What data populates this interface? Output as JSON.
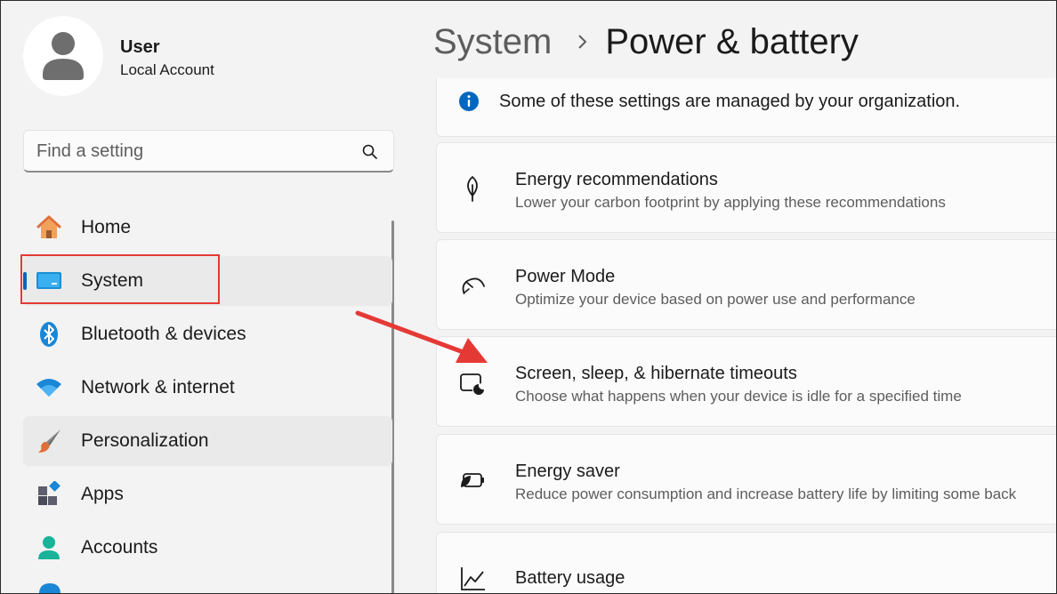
{
  "user": {
    "name": "User",
    "account_type": "Local Account"
  },
  "search": {
    "placeholder": "Find a setting",
    "value": ""
  },
  "nav": {
    "items": [
      {
        "label": "Home",
        "icon": "home-icon"
      },
      {
        "label": "System",
        "icon": "monitor-icon"
      },
      {
        "label": "Bluetooth & devices",
        "icon": "bluetooth-icon"
      },
      {
        "label": "Network & internet",
        "icon": "wifi-icon"
      },
      {
        "label": "Personalization",
        "icon": "paintbrush-icon"
      },
      {
        "label": "Apps",
        "icon": "apps-icon"
      },
      {
        "label": "Accounts",
        "icon": "person-icon"
      }
    ],
    "selected": "System"
  },
  "breadcrumb": {
    "parent": "System",
    "current": "Power & battery"
  },
  "notice": {
    "text": "Some of these settings are managed by your organization."
  },
  "cards": [
    {
      "title": "Energy recommendations",
      "description": "Lower your carbon footprint by applying these recommendations",
      "icon": "leaf-icon"
    },
    {
      "title": "Power Mode",
      "description": "Optimize your device based on power use and performance",
      "icon": "speedometer-icon"
    },
    {
      "title": "Screen, sleep, & hibernate timeouts",
      "description": "Choose what happens when your device is idle for a specified time",
      "icon": "screen-sleep-icon"
    },
    {
      "title": "Energy saver",
      "description": "Reduce power consumption and increase battery life by limiting some back",
      "icon": "battery-leaf-icon"
    },
    {
      "title": "Battery usage",
      "description": "",
      "icon": "chart-line-icon"
    }
  ],
  "colors": {
    "accent": "#0067c0",
    "annotation": "#e53935",
    "background": "#f3f3f3",
    "card": "#fbfbfb"
  }
}
